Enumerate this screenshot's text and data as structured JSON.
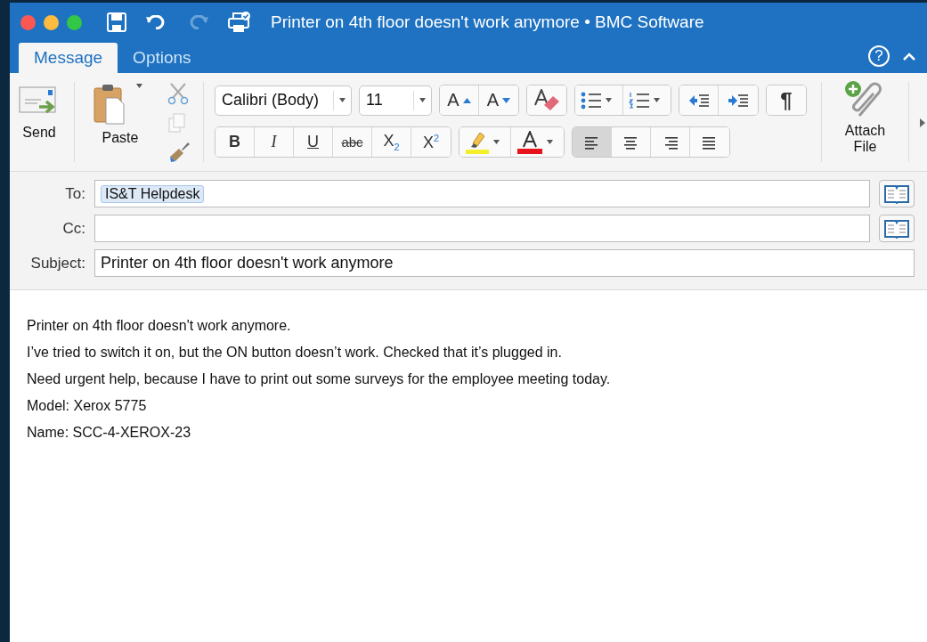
{
  "window": {
    "title": "Printer on 4th floor doesn't work anymore • BMC Software",
    "help": "?"
  },
  "tabs": [
    {
      "label": "Message",
      "selected": true
    },
    {
      "label": "Options",
      "selected": false
    }
  ],
  "ribbon": {
    "send": "Send",
    "paste": "Paste",
    "font": "Calibri (Body)",
    "size": "11",
    "pilcrow": "¶",
    "attach": "Attach File",
    "format_buttons": [
      {
        "kind": "bold",
        "label": "B"
      },
      {
        "kind": "italic",
        "label": "I"
      },
      {
        "kind": "underline",
        "label": "U"
      },
      {
        "kind": "strike",
        "label": "abc"
      },
      {
        "kind": "sub",
        "label": "X$_{2}$"
      },
      {
        "kind": "sup",
        "label": "X$^{2}$"
      }
    ],
    "grow_label": "A",
    "shrink_label": "A",
    "align": [
      {
        "kind": "left",
        "selected": true
      },
      {
        "kind": "center",
        "selected": false
      },
      {
        "kind": "right",
        "selected": false
      },
      {
        "kind": "justify",
        "selected": false
      }
    ]
  },
  "fields": [
    {
      "label": "To:",
      "kind": "recipients",
      "chips": [
        "IS&T Helpdesk"
      ]
    },
    {
      "label": "Cc:",
      "kind": "recipients"
    },
    {
      "label": "Subject:",
      "kind": "text",
      "value": "Printer on 4th floor doesn't work anymore"
    }
  ],
  "body": [
    "Printer on 4th floor doesn't work anymore.",
    "I’ve tried to switch it on, but the ON button doesn’t work. Checked that it’s plugged in.",
    "Need urgent help, because I have to print out some surveys for the employee meeting today.",
    "Model:  Xerox 5775",
    "Name:  SCC-4-XEROX-23"
  ]
}
